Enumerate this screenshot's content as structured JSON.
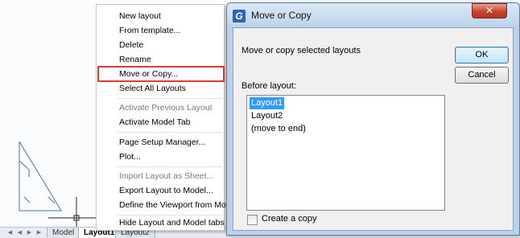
{
  "context_menu": {
    "items": [
      {
        "label": "New layout",
        "enabled": true
      },
      {
        "label": "From template...",
        "enabled": true
      },
      {
        "label": "Delete",
        "enabled": true
      },
      {
        "label": "Rename",
        "enabled": true
      },
      {
        "label": "Move or Copy...",
        "enabled": true,
        "highlighted": true
      },
      {
        "label": "Select All Layouts",
        "enabled": true
      },
      {
        "label": "Activate Previous Layout",
        "enabled": false
      },
      {
        "label": "Activate Model Tab",
        "enabled": true
      },
      {
        "label": "Page Setup Manager...",
        "enabled": true
      },
      {
        "label": "Plot...",
        "enabled": true
      },
      {
        "label": "Import Layout as Sheet...",
        "enabled": false
      },
      {
        "label": "Export Layout to Model...",
        "enabled": true
      },
      {
        "label": "Define the Viewport from Mod",
        "enabled": true
      },
      {
        "label": "Hide Layout and Model tabs",
        "enabled": true
      }
    ]
  },
  "tabs": {
    "items": [
      {
        "label": "Model",
        "active": false
      },
      {
        "label": "Layout1",
        "active": true
      },
      {
        "label": "Layout2",
        "active": false
      }
    ]
  },
  "dialog": {
    "title": "Move or Copy",
    "app_icon_glyph": "G",
    "close_glyph": "✕",
    "description": "Move or copy selected layouts",
    "ok_label": "OK",
    "cancel_label": "Cancel",
    "list_label": "Before layout:",
    "list_items": [
      {
        "label": "Layout1",
        "selected": true
      },
      {
        "label": "Layout2",
        "selected": false
      },
      {
        "label": "(move to end)",
        "selected": false
      }
    ],
    "create_copy_label": "Create a copy",
    "create_copy_checked": false
  },
  "colors": {
    "highlight_outline": "#e0392f",
    "selection": "#3399ff",
    "close_button": "#c8452e",
    "dialog_frame": "#b9d1ea"
  },
  "icons": {
    "app": "gstarcad-logo-icon",
    "close": "close-icon",
    "nav": [
      "first-tab-icon",
      "prev-tab-icon",
      "next-tab-icon",
      "last-tab-icon"
    ]
  }
}
